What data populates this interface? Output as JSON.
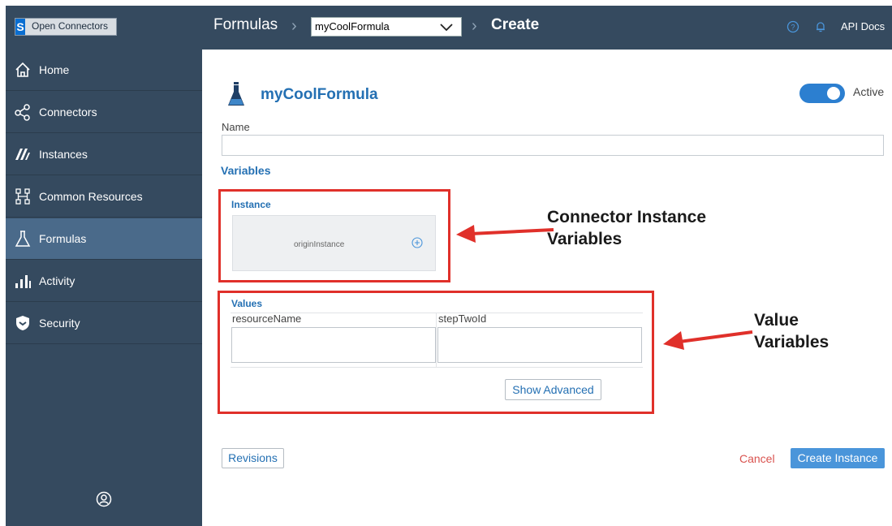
{
  "app": {
    "logo_text": "Open Connectors"
  },
  "header": {
    "crumb_formulas": "Formulas",
    "selected_formula": "myCoolFormula",
    "crumb_create": "Create",
    "api_docs": "API Docs"
  },
  "sidebar": {
    "items": [
      {
        "label": "Home",
        "icon": "home-icon"
      },
      {
        "label": "Connectors",
        "icon": "share-icon"
      },
      {
        "label": "Instances",
        "icon": "instances-icon"
      },
      {
        "label": "Common Resources",
        "icon": "resources-icon"
      },
      {
        "label": "Formulas",
        "icon": "flask-icon",
        "active": true
      },
      {
        "label": "Activity",
        "icon": "bar-chart-icon"
      },
      {
        "label": "Security",
        "icon": "shield-icon"
      }
    ]
  },
  "main": {
    "formula_name": "myCoolFormula",
    "active_label": "Active",
    "active": true,
    "name_label": "Name",
    "name_value": "",
    "variables_title": "Variables",
    "instance_section_title": "Instance",
    "instance_variable": "originInstance",
    "values_section_title": "Values",
    "value_columns": [
      "resourceName",
      "stepTwoId"
    ],
    "show_advanced": "Show Advanced",
    "revisions": "Revisions",
    "cancel": "Cancel",
    "create_instance": "Create Instance"
  },
  "annotations": {
    "connector_instance": [
      "Connector Instance",
      "Variables"
    ],
    "value_variables": [
      "Value",
      "Variables"
    ]
  },
  "colors": {
    "sidebar_bg": "#354a5f",
    "sidebar_active": "#4a6a8a",
    "accent": "#2470b3",
    "primary_button": "#4a95da",
    "cancel": "#d9534f",
    "annotation_red": "#e0302a"
  }
}
